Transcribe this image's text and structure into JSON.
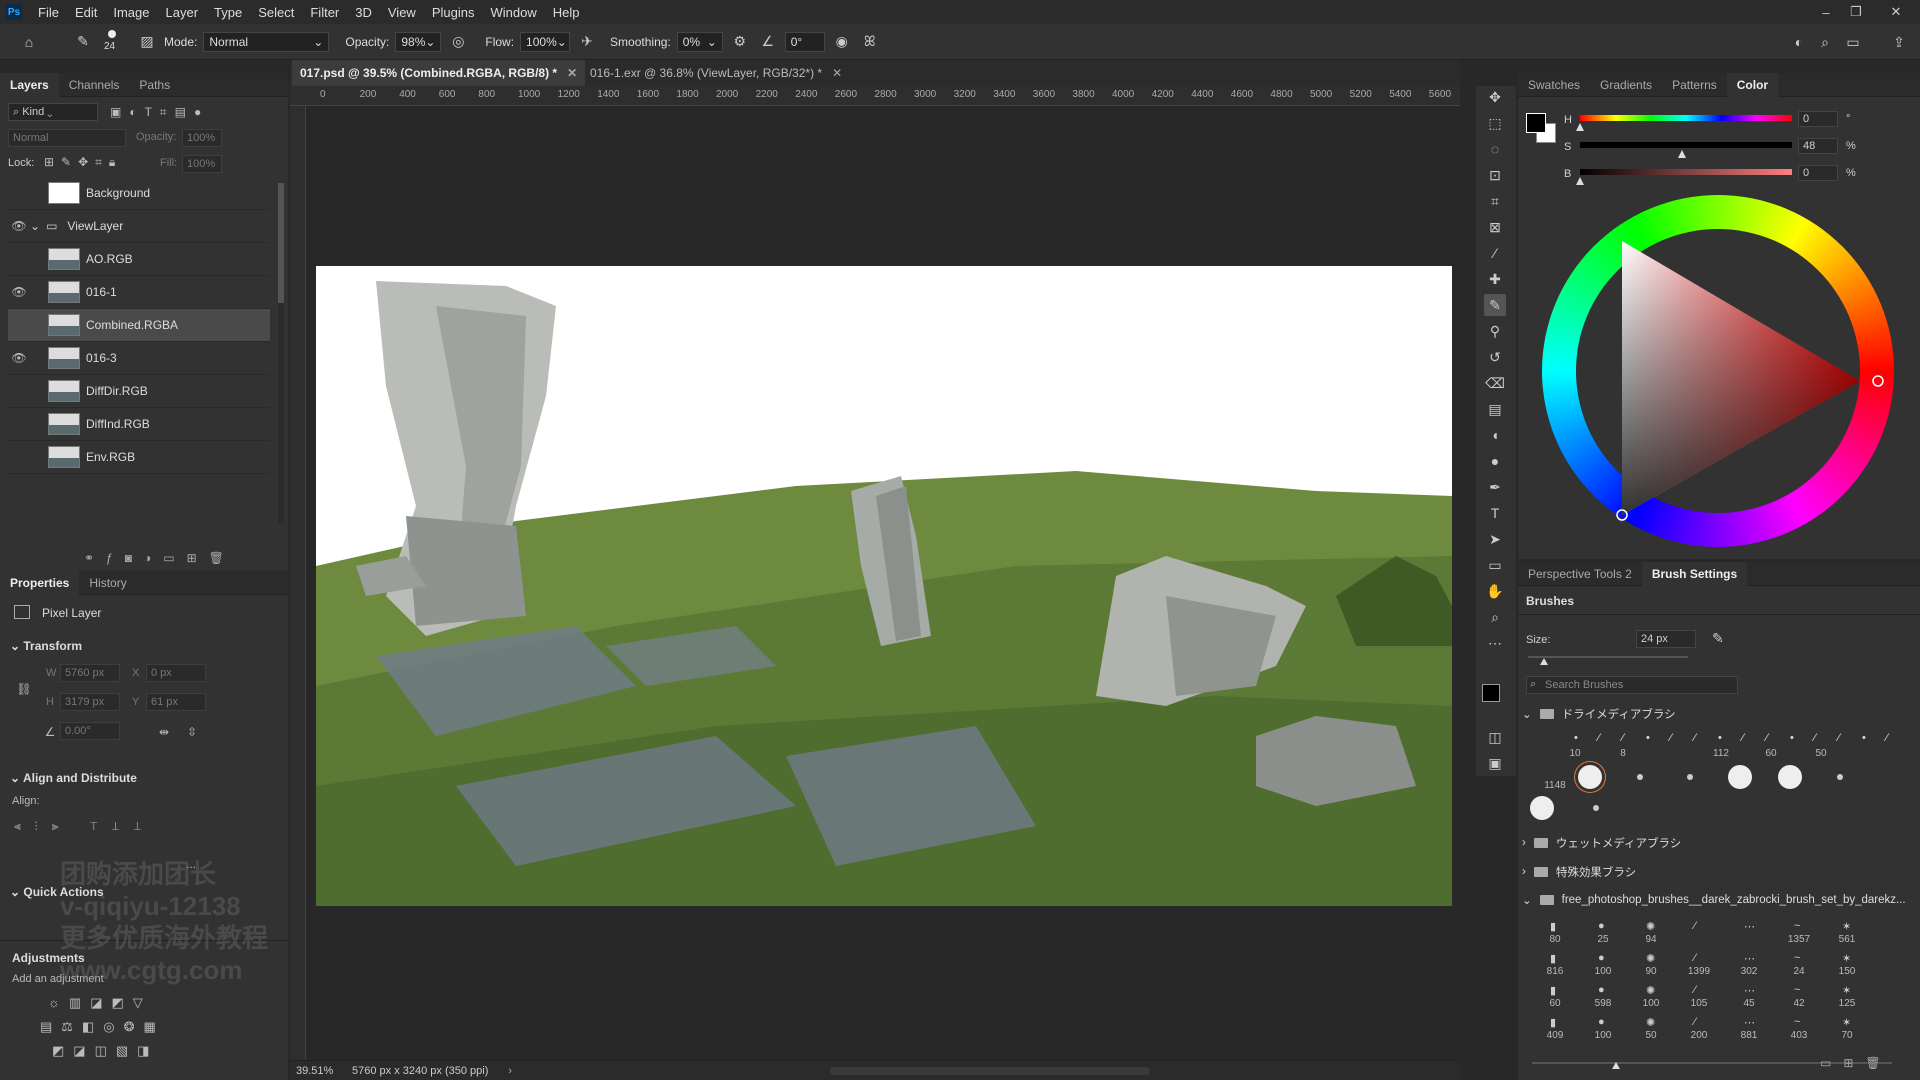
{
  "menubar": {
    "logo": "Ps",
    "items": [
      "File",
      "Edit",
      "Image",
      "Layer",
      "Type",
      "Select",
      "Filter",
      "3D",
      "View",
      "Plugins",
      "Window",
      "Help"
    ],
    "min": "–",
    "restore": "❐",
    "close": "✕"
  },
  "options": {
    "brush_size": "24",
    "mode_label": "Mode:",
    "mode_value": "Normal",
    "opacity_label": "Opacity:",
    "opacity_value": "98%",
    "flow_label": "Flow:",
    "flow_value": "100%",
    "smoothing_label": "Smoothing:",
    "smoothing_value": "0%",
    "angle_value": "0°"
  },
  "layers_panel": {
    "tabs": [
      "Layers",
      "Channels",
      "Paths"
    ],
    "filter_kind": "Kind",
    "blend": "Normal",
    "opacity_label": "Opacity:",
    "opacity_value": "100%",
    "lock_label": "Lock:",
    "fill_label": "Fill:",
    "fill_value": "100%",
    "layers": [
      {
        "name": "Background",
        "visible": false,
        "selected": false
      },
      {
        "name": "ViewLayer",
        "visible": true,
        "group": true
      },
      {
        "name": "AO.RGB",
        "visible": false
      },
      {
        "name": "016-1",
        "visible": true
      },
      {
        "name": "Combined.RGBA",
        "visible": false,
        "selected": true
      },
      {
        "name": "016-3",
        "visible": true
      },
      {
        "name": "DiffDir.RGB",
        "visible": false
      },
      {
        "name": "DiffInd.RGB",
        "visible": false
      },
      {
        "name": "Env.RGB",
        "visible": false
      }
    ]
  },
  "properties": {
    "tabs": [
      "Properties",
      "History"
    ],
    "type": "Pixel Layer",
    "transform_title": "Transform",
    "w": "5760 px",
    "x": "0 px",
    "h": "3179 px",
    "y": "61 px",
    "angle": "0.00°",
    "align_title": "Align and Distribute",
    "align_label": "Align:",
    "more": "...",
    "quick_actions": "Quick Actions",
    "adjustments": "Adjustments",
    "add_adjustment": "Add an adjustment"
  },
  "documents": [
    {
      "title": "017.psd @ 39.5% (Combined.RGBA, RGB/8) *",
      "active": true
    },
    {
      "title": "016-1.exr @ 36.8% (ViewLayer, RGB/32*) *",
      "active": false
    }
  ],
  "ruler": {
    "h": [
      "0",
      "200",
      "400",
      "600",
      "800",
      "1000",
      "1200",
      "1400",
      "1600",
      "1800",
      "2000",
      "2200",
      "2400",
      "2600",
      "2800",
      "3000",
      "3200",
      "3400",
      "3600",
      "3800",
      "4000",
      "4200",
      "4400",
      "4600",
      "4800",
      "5000",
      "5200",
      "5400",
      "5600"
    ]
  },
  "status": {
    "zoom": "39.51%",
    "doc_info": "5760 px x 3240 px (350 ppi)"
  },
  "color_panel": {
    "tabs": [
      "Swatches",
      "Gradients",
      "Patterns",
      "Color"
    ],
    "h_label": "H",
    "s_label": "S",
    "b_label": "B",
    "h_value": "0",
    "s_value": "48",
    "b_value": "0",
    "deg": "°",
    "pct": "%",
    "hue_degrees": 0,
    "saturation": 48,
    "brightness": 0
  },
  "brush_panel": {
    "tabs": [
      "Perspective Tools 2",
      "Brush Settings"
    ],
    "title": "Brushes",
    "size_label": "Size:",
    "size_value": "24 px",
    "search_placeholder": "Search Brushes",
    "folders": [
      "ドライメディアブラシ",
      "ウェットメディアブラシ",
      "特殊効果ブラシ",
      "free_photoshop_brushes__darek_zabrocki_brush_set_by_darekz..."
    ],
    "dry_row1": [
      "10",
      "8",
      "112",
      "60",
      "50"
    ],
    "dry_row2": [
      "1148"
    ],
    "grid_nums": [
      "80",
      "25",
      "94",
      "",
      "",
      "1357",
      "561",
      "816",
      "100",
      "90",
      "1399",
      "302",
      "24",
      "150",
      "60",
      "598",
      "100",
      "105",
      "45",
      "42",
      "125",
      "409",
      "100",
      "50",
      "200",
      "881",
      "403",
      "70"
    ]
  },
  "watermark": {
    "l1": "团购添加团长",
    "l2": "v-qiqiyu-12138",
    "l3": "更多优质海外教程",
    "l4": "www.cgtg.com"
  },
  "colors": {
    "accent": "#4f8ad9",
    "fg": "#000000",
    "bg": "#ffffff"
  }
}
